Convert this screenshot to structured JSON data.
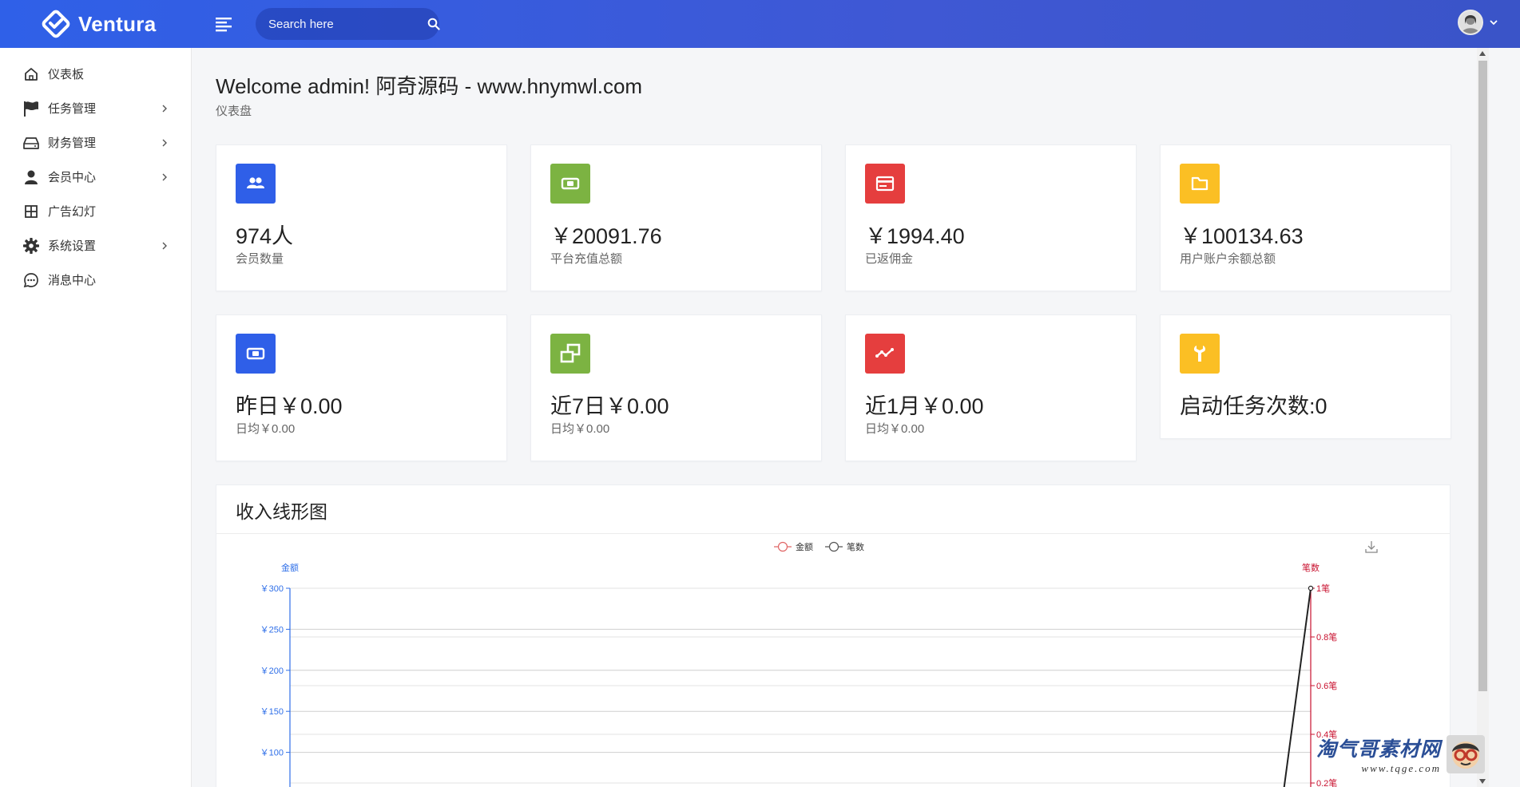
{
  "app": {
    "name": "Ventura"
  },
  "header": {
    "search_placeholder": "Search here"
  },
  "sidebar": {
    "items": [
      {
        "label": "仪表板",
        "icon": "home-icon",
        "has_children": false
      },
      {
        "label": "任务管理",
        "icon": "flag-icon",
        "has_children": true
      },
      {
        "label": "财务管理",
        "icon": "drive-icon",
        "has_children": true
      },
      {
        "label": "会员中心",
        "icon": "user-icon",
        "has_children": true
      },
      {
        "label": "广告幻灯",
        "icon": "grid-icon",
        "has_children": false
      },
      {
        "label": "系统设置",
        "icon": "gear-icon",
        "has_children": true
      },
      {
        "label": "消息中心",
        "icon": "chat-icon",
        "has_children": false
      }
    ]
  },
  "page": {
    "title": "Welcome admin! 阿奇源码 - www.hnymwl.com",
    "subtitle": "仪表盘"
  },
  "stats_row1": [
    {
      "value": "974人",
      "label": "会员数量",
      "icon": "users-icon",
      "color": "#2f5fe8"
    },
    {
      "value": "￥20091.76",
      "label": "平台充值总额",
      "icon": "money-icon",
      "color": "#7cb342"
    },
    {
      "value": "￥1994.40",
      "label": "已返佣金",
      "icon": "card-icon",
      "color": "#e53e3e"
    },
    {
      "value": "￥100134.63",
      "label": "用户账户余额总额",
      "icon": "folder-icon",
      "color": "#fbbf24"
    }
  ],
  "stats_row2": [
    {
      "value": "昨日￥0.00",
      "label": "日均￥0.00",
      "icon": "money-icon",
      "color": "#2f5fe8"
    },
    {
      "value": "近7日￥0.00",
      "label": "日均￥0.00",
      "icon": "windows-icon",
      "color": "#7cb342"
    },
    {
      "value": "近1月￥0.00",
      "label": "日均￥0.00",
      "icon": "trend-icon",
      "color": "#e53e3e"
    },
    {
      "value": "启动任务次数:0",
      "label": "",
      "icon": "wrench-icon",
      "color": "#fbbf24"
    }
  ],
  "chart_section": {
    "title": "收入线形图"
  },
  "chart_data": {
    "type": "line",
    "legend": [
      "金额",
      "笔数"
    ],
    "legend_position": "top-center",
    "y_left": {
      "name": "金额",
      "ticks": [
        "￥100",
        "￥150",
        "￥200",
        "￥250",
        "￥300"
      ],
      "range": [
        0,
        300
      ],
      "color": "#2f6fe8"
    },
    "y_right": {
      "name": "笔数",
      "ticks": [
        "0.2笔",
        "0.4笔",
        "0.6笔",
        "0.8笔",
        "1笔"
      ],
      "range": [
        0,
        1
      ],
      "color": "#c8102e"
    },
    "series": [
      {
        "name": "笔数",
        "axis": "right",
        "end_value": 1
      }
    ],
    "grid": true
  },
  "watermark": {
    "title": "淘气哥素材网",
    "url": "www.tqge.com"
  }
}
